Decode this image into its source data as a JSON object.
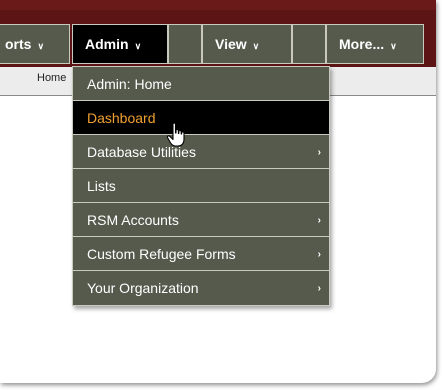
{
  "nav": {
    "items": [
      {
        "label": "orts",
        "chevron": "chevron-down-icon"
      },
      {
        "label": "Admin",
        "chevron": "chevron-down-icon"
      },
      {
        "label": "View",
        "chevron": "chevron-down-icon"
      },
      {
        "label": "More...",
        "chevron": "chevron-down-icon"
      }
    ],
    "chevron_glyph": "∨"
  },
  "breadcrumb": {
    "label": "Home"
  },
  "admin_menu": {
    "items": [
      {
        "label": "Admin: Home",
        "has_submenu": false
      },
      {
        "label": "Dashboard",
        "has_submenu": false,
        "selected": true
      },
      {
        "label": "Database Utilities",
        "has_submenu": true
      },
      {
        "label": "Lists",
        "has_submenu": false
      },
      {
        "label": "RSM Accounts",
        "has_submenu": true
      },
      {
        "label": "Custom Refugee Forms",
        "has_submenu": true
      },
      {
        "label": "Your Organization",
        "has_submenu": true
      }
    ],
    "submenu_arrow": "›"
  },
  "colors": {
    "menubar_bg": "#5c1414",
    "item_bg": "#555a4d",
    "active_bg": "#000000",
    "highlight_text": "#f0a030"
  }
}
